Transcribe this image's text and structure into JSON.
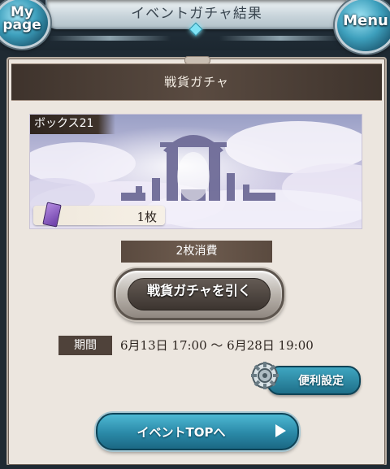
{
  "header": {
    "title": "イベントガチャ結果",
    "left_button_label": "My page",
    "left_button_line1": "My",
    "left_button_line2": "page",
    "right_button_label": "Menu"
  },
  "panel": {
    "title": "戦貨ガチャ"
  },
  "banner": {
    "box_label": "ボックス21",
    "ticket_count": "1枚",
    "ticket_icon": "purple-ticket-icon"
  },
  "cost": {
    "label": "2枚消費"
  },
  "draw_button": {
    "label": "戦貨ガチャを引く"
  },
  "period": {
    "label": "期間",
    "value": "6月13日 17:00 ～ 6月28日 19:00"
  },
  "settings_button": {
    "label": "便利設定",
    "icon": "gear-icon"
  },
  "event_top_button": {
    "label": "イベントTOPへ",
    "icon": "play-arrow-icon"
  },
  "colors": {
    "panel_bg": "#ece6df",
    "header_dark": "#3e332c",
    "accent_blue": "#2a89a7"
  }
}
